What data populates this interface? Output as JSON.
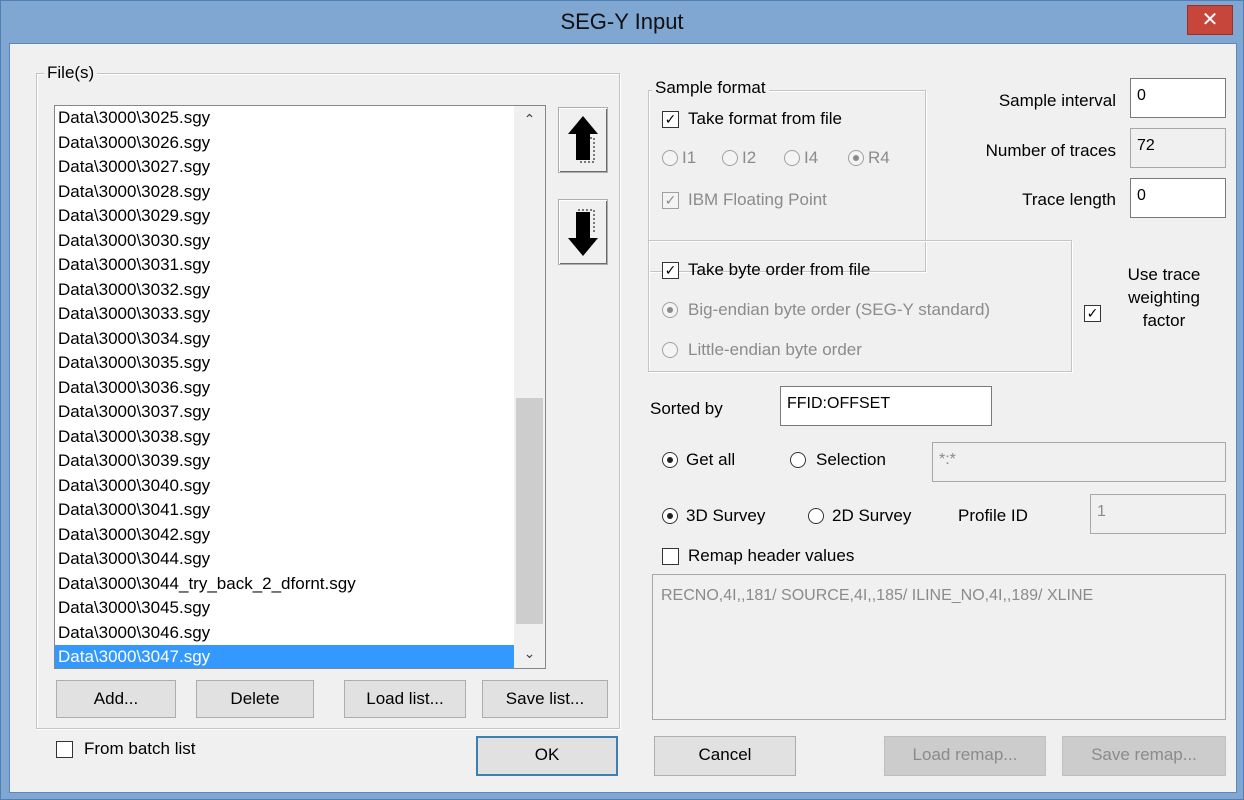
{
  "window": {
    "title": "SEG-Y Input",
    "close_glyph": "✕"
  },
  "files": {
    "legend": "File(s)",
    "items": [
      "Data\\3000\\3025.sgy",
      "Data\\3000\\3026.sgy",
      "Data\\3000\\3027.sgy",
      "Data\\3000\\3028.sgy",
      "Data\\3000\\3029.sgy",
      "Data\\3000\\3030.sgy",
      "Data\\3000\\3031.sgy",
      "Data\\3000\\3032.sgy",
      "Data\\3000\\3033.sgy",
      "Data\\3000\\3034.sgy",
      "Data\\3000\\3035.sgy",
      "Data\\3000\\3036.sgy",
      "Data\\3000\\3037.sgy",
      "Data\\3000\\3038.sgy",
      "Data\\3000\\3039.sgy",
      "Data\\3000\\3040.sgy",
      "Data\\3000\\3041.sgy",
      "Data\\3000\\3042.sgy",
      "Data\\3000\\3044.sgy",
      "Data\\3000\\3044_try_back_2_dfornt.sgy",
      "Data\\3000\\3045.sgy",
      "Data\\3000\\3046.sgy",
      "Data\\3000\\3047.sgy"
    ],
    "selected_index": 22,
    "add_label": "Add...",
    "delete_label": "Delete",
    "load_list_label": "Load list...",
    "save_list_label": "Save list...",
    "move_up_icon": "arrow-up-icon",
    "move_down_icon": "arrow-down-icon"
  },
  "sample_format": {
    "legend": "Sample format",
    "take_from_file_label": "Take format from file",
    "take_from_file_checked": true,
    "options": [
      "I1",
      "I2",
      "I4",
      "R4"
    ],
    "selected_option": "R4",
    "ibm_label": "IBM Floating Point",
    "ibm_checked": true
  },
  "sample_interval": {
    "label": "Sample interval",
    "value": "0"
  },
  "number_of_traces": {
    "label": "Number of traces",
    "value": "72"
  },
  "trace_length": {
    "label": "Trace length",
    "value": "0"
  },
  "byte_order": {
    "take_from_file_label": "Take byte order from file",
    "take_from_file_checked": true,
    "big_endian_label": "Big-endian byte order (SEG-Y standard)",
    "little_endian_label": "Little-endian byte order",
    "selected": "big"
  },
  "trace_weighting": {
    "label": "Use trace weighting factor",
    "checked": true
  },
  "sorted_by": {
    "label": "Sorted by",
    "value": "FFID:OFFSET"
  },
  "selection": {
    "get_all_label": "Get all",
    "selection_label": "Selection",
    "selected": "get_all",
    "value": "*:*"
  },
  "survey": {
    "survey_3d_label": "3D Survey",
    "survey_2d_label": "2D Survey",
    "selected": "3d",
    "profile_id_label": "Profile ID",
    "profile_id_value": "1"
  },
  "remap": {
    "label": "Remap header values",
    "checked": false,
    "value": "RECNO,4I,,181/ SOURCE,4I,,185/ ILINE_NO,4I,,189/ XLINE"
  },
  "footer": {
    "from_batch_label": "From batch list",
    "from_batch_checked": false,
    "ok_label": "OK",
    "cancel_label": "Cancel",
    "load_remap_label": "Load remap...",
    "save_remap_label": "Save remap..."
  }
}
